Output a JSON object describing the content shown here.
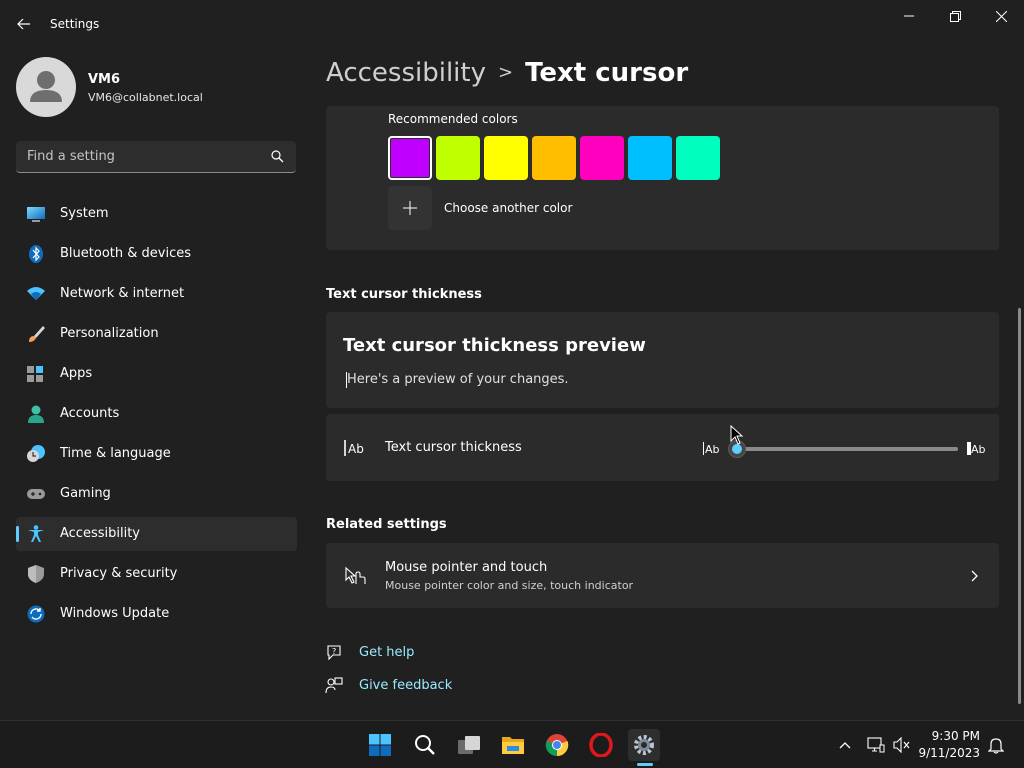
{
  "window": {
    "app_title": "Settings",
    "back_icon": "arrow-left-icon",
    "controls": [
      "minimize-icon",
      "maximize-icon",
      "close-icon"
    ]
  },
  "profile": {
    "name": "VM6",
    "email": "VM6@collabnet.local"
  },
  "search": {
    "placeholder": "Find a setting",
    "icon": "search-icon"
  },
  "sidebar": {
    "items": [
      {
        "label": "System",
        "icon": "system-icon"
      },
      {
        "label": "Bluetooth & devices",
        "icon": "bluetooth-icon"
      },
      {
        "label": "Network & internet",
        "icon": "wifi-icon"
      },
      {
        "label": "Personalization",
        "icon": "paintbrush-icon"
      },
      {
        "label": "Apps",
        "icon": "apps-icon"
      },
      {
        "label": "Accounts",
        "icon": "person-icon"
      },
      {
        "label": "Time & language",
        "icon": "clock-globe-icon"
      },
      {
        "label": "Gaming",
        "icon": "gamepad-icon"
      },
      {
        "label": "Accessibility",
        "icon": "accessibility-icon",
        "active": true
      },
      {
        "label": "Privacy & security",
        "icon": "shield-icon"
      },
      {
        "label": "Windows Update",
        "icon": "update-icon"
      }
    ]
  },
  "breadcrumb": {
    "parent": "Accessibility",
    "separator": ">",
    "current": "Text cursor"
  },
  "colors_card": {
    "label": "Recommended colors",
    "swatches": [
      "#bf00ff",
      "#bfff00",
      "#ffff00",
      "#ffbf00",
      "#ff00bf",
      "#00bfff",
      "#00ffbf"
    ],
    "selected_index": 0,
    "add_icon": "plus-icon",
    "choose_label": "Choose another color"
  },
  "thickness": {
    "section_title": "Text cursor thickness",
    "preview_title": "Text cursor thickness preview",
    "preview_text": "Here's a preview of your changes.",
    "setting_label": "Text cursor thickness",
    "setting_icon": "text-cursor-icon",
    "min_label": "Ab",
    "max_label": "Ab",
    "slider_value": 1,
    "slider_min": 1,
    "slider_max": 20
  },
  "related": {
    "section_title": "Related settings",
    "item_title": "Mouse pointer and touch",
    "item_subtitle": "Mouse pointer color and size, touch indicator",
    "item_icon": "mouse-touch-icon",
    "chevron_icon": "chevron-right-icon"
  },
  "links": {
    "help": "Get help",
    "feedback": "Give feedback"
  },
  "taskbar": {
    "apps": [
      "windows-start-icon",
      "search-icon",
      "task-view-icon",
      "file-explorer-icon",
      "chrome-icon",
      "opera-icon",
      "settings-gear-icon"
    ],
    "tray": [
      "chevron-up-icon",
      "network-icon",
      "volume-muted-icon",
      "notification-bell-icon"
    ],
    "time": "9:30 PM",
    "date": "9/11/2023"
  },
  "colors": {
    "accent": "#60cdff",
    "background": "#202020",
    "card": "#2b2b2b",
    "link": "#99ebff"
  }
}
